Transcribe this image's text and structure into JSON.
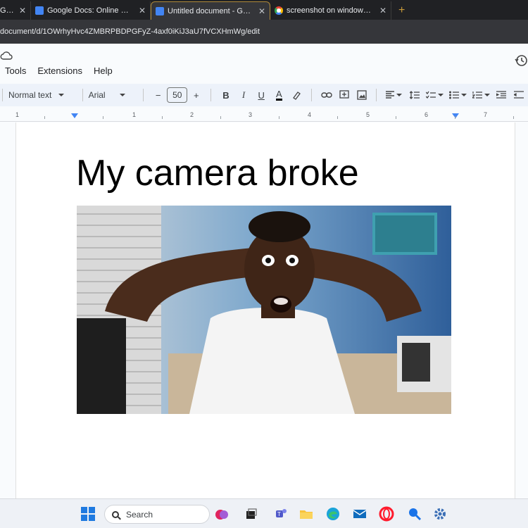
{
  "browser": {
    "tabs": [
      {
        "title": "Google",
        "active": false,
        "favicon": "google-docs-icon"
      },
      {
        "title": "Google Docs: Online Document",
        "active": false,
        "favicon": "google-docs-icon"
      },
      {
        "title": "Untitled document - Google Docs",
        "active": true,
        "favicon": "google-docs-icon"
      },
      {
        "title": "screenshot on windows - Google",
        "active": false,
        "favicon": "google-icon"
      }
    ],
    "close_glyph": "✕",
    "new_tab_glyph": "+",
    "url": "document/d/1OWrhyHvc4ZMBRPBDPGFyZ-4axf0iKiJ3aU7fVCXHmWg/edit"
  },
  "docs": {
    "menus": [
      "Tools",
      "Extensions",
      "Help"
    ],
    "toolbar": {
      "style": "Normal text",
      "font": "Arial",
      "font_size": "50",
      "minus": "−",
      "plus": "+",
      "bold": "B",
      "italic": "I",
      "underline": "U",
      "text_color": "A"
    },
    "ruler_labels": [
      "1",
      "1",
      "2",
      "3",
      "4",
      "5",
      "6",
      "7"
    ],
    "document": {
      "title_text": "My camera broke"
    }
  },
  "taskbar": {
    "search_label": "Search"
  },
  "colors": {
    "accent": "#4285f4",
    "tabbar_bg": "#202124",
    "toolbar_bg": "#edf2fa",
    "taskbar_bg": "#eef1f6"
  }
}
